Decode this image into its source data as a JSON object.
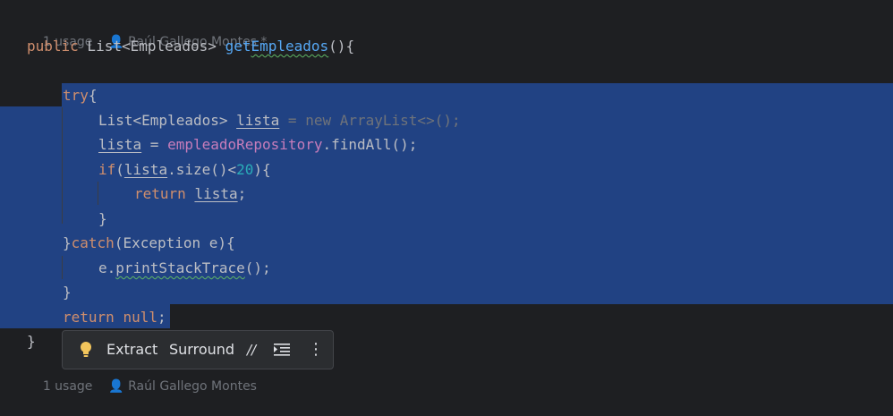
{
  "hints": {
    "top": {
      "usages": "1 usage",
      "author": "Raúl Gallego Montes *"
    },
    "bottom": {
      "usages": "1 usage",
      "author": "Raúl Gallego Montes"
    }
  },
  "code": {
    "l1": {
      "kw": "public",
      "type": " List<Empleados> ",
      "method": "getEmpleados",
      "rest": "(){"
    },
    "l3": {
      "kw": "try",
      "rest": "{"
    },
    "l4": {
      "type": "List<Empleados> ",
      "var": "lista",
      "eq": " = ",
      "dim": "new ArrayList<>();"
    },
    "l5": {
      "var": "lista",
      "eq": " = ",
      "field": "empleadoRepository",
      "rest": ".findAll();"
    },
    "l6": {
      "kw": "if",
      "open": "(",
      "var": "lista",
      "mid": ".size()<",
      "num": "20",
      "rest": "){"
    },
    "l7": {
      "kw": "return",
      "sp": " ",
      "var": "lista",
      "rest": ";"
    },
    "l8": {
      "rest": "}"
    },
    "l9": {
      "open": "}",
      "kw": "catch",
      "rest": "(Exception e){"
    },
    "l10": {
      "pre": "e.",
      "method": "printStackTrace",
      "rest": "();"
    },
    "l11": {
      "rest": "}"
    },
    "l12": {
      "kw": "return",
      "sp": " ",
      "kw2": "null",
      "rest": ";"
    },
    "l13": {
      "rest": "}"
    }
  },
  "toolbar": {
    "extract_label": "Extract",
    "surround_label": "Surround",
    "comment_icon": "//",
    "more_icon": "⋮"
  },
  "colors": {
    "background": "#1e1f22",
    "selection": "#214283",
    "keyword": "#cf8e6d",
    "method": "#56a8f5",
    "field": "#c77dbb",
    "number": "#2aacb8"
  }
}
